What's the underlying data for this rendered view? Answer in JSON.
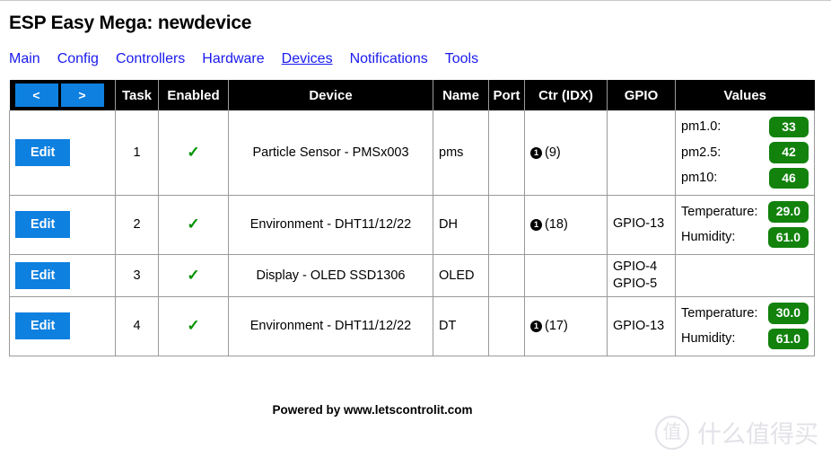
{
  "page": {
    "title": "ESP Easy Mega: newdevice"
  },
  "nav": {
    "items": [
      {
        "label": "Main",
        "active": false
      },
      {
        "label": "Config",
        "active": false
      },
      {
        "label": "Controllers",
        "active": false
      },
      {
        "label": "Hardware",
        "active": false
      },
      {
        "label": "Devices",
        "active": true
      },
      {
        "label": "Notifications",
        "active": false
      },
      {
        "label": "Tools",
        "active": false
      }
    ]
  },
  "pager": {
    "prev_label": "<",
    "next_label": ">"
  },
  "table": {
    "headers": {
      "task": "Task",
      "enabled": "Enabled",
      "device": "Device",
      "name": "Name",
      "port": "Port",
      "ctr": "Ctr (IDX)",
      "gpio": "GPIO",
      "values": "Values"
    },
    "edit_label": "Edit",
    "enabled_mark": "✓",
    "rows": [
      {
        "task": "1",
        "enabled": true,
        "device": "Particle Sensor - PMSx003",
        "name": "pms",
        "port": "",
        "ctr_num": "1",
        "ctr_idx": "(9)",
        "gpio": [],
        "values": [
          {
            "label": "pm1.0:",
            "value": "33"
          },
          {
            "label": "pm2.5:",
            "value": "42"
          },
          {
            "label": "pm10:",
            "value": "46"
          }
        ]
      },
      {
        "task": "2",
        "enabled": true,
        "device": "Environment - DHT11/12/22",
        "name": "DH",
        "port": "",
        "ctr_num": "1",
        "ctr_idx": "(18)",
        "gpio": [
          "GPIO-13"
        ],
        "values": [
          {
            "label": "Temperature:",
            "value": "29.0"
          },
          {
            "label": "Humidity:",
            "value": "61.0"
          }
        ]
      },
      {
        "task": "3",
        "enabled": true,
        "device": "Display - OLED SSD1306",
        "name": "OLED",
        "port": "",
        "ctr_num": "",
        "ctr_idx": "",
        "gpio": [
          "GPIO-4",
          "GPIO-5"
        ],
        "values": []
      },
      {
        "task": "4",
        "enabled": true,
        "device": "Environment - DHT11/12/22",
        "name": "DT",
        "port": "",
        "ctr_num": "1",
        "ctr_idx": "(17)",
        "gpio": [
          "GPIO-13"
        ],
        "values": [
          {
            "label": "Temperature:",
            "value": "30.0"
          },
          {
            "label": "Humidity:",
            "value": "61.0"
          }
        ]
      }
    ]
  },
  "footer": {
    "text": "Powered by www.letscontrolit.com"
  },
  "watermark": {
    "mark": "值",
    "text": "什么值得买"
  },
  "colors": {
    "accent_blue": "#0e80e0",
    "link_blue": "#1a1aee",
    "badge_green": "#12820c",
    "check_green": "#009000",
    "header_black": "#000000"
  }
}
